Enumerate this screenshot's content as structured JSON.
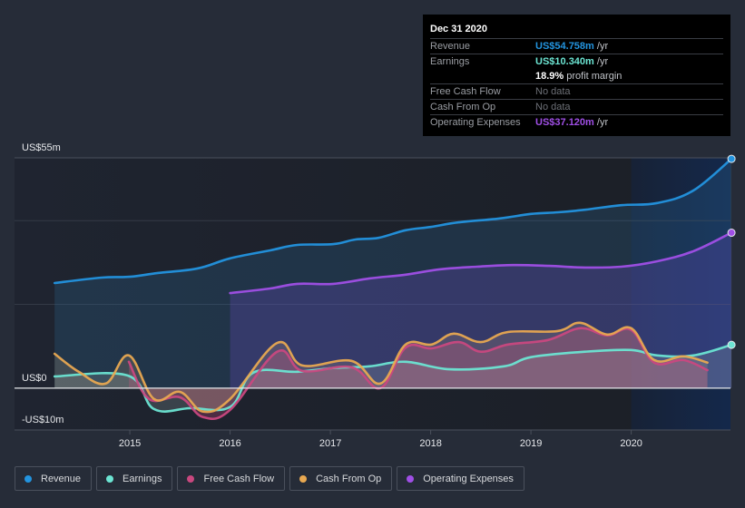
{
  "tooltip": {
    "date": "Dec 31 2020",
    "rows": [
      {
        "label": "Revenue",
        "value": "US$54.758m",
        "unit": "/yr",
        "color": "#2394df"
      },
      {
        "label": "Earnings",
        "value": "US$10.340m",
        "unit": "/yr",
        "color": "#6ce5d3"
      },
      {
        "label": "",
        "value": "18.9%",
        "unit": "profit margin",
        "color": "#ffffff"
      },
      {
        "label": "Free Cash Flow",
        "value": "No data",
        "unit": "",
        "color": "#6d7077"
      },
      {
        "label": "Cash From Op",
        "value": "No data",
        "unit": "",
        "color": "#6d7077"
      },
      {
        "label": "Operating Expenses",
        "value": "US$37.120m",
        "unit": "/yr",
        "color": "#a04fe6"
      }
    ]
  },
  "legend": [
    {
      "label": "Revenue",
      "color": "#2394df"
    },
    {
      "label": "Earnings",
      "color": "#6ce5d3"
    },
    {
      "label": "Free Cash Flow",
      "color": "#c9487f"
    },
    {
      "label": "Cash From Op",
      "color": "#e8a851"
    },
    {
      "label": "Operating Expenses",
      "color": "#a04fe6"
    }
  ],
  "chart_data": {
    "type": "line",
    "title": "",
    "xlabel": "",
    "ylabel": "",
    "y_tick_labels": [
      "US$55m",
      "US$0",
      "-US$10m"
    ],
    "ylim": [
      -10,
      55
    ],
    "xlim": [
      2013.85,
      2020.99
    ],
    "x_tick_labels": [
      "2015",
      "2016",
      "2017",
      "2018",
      "2019",
      "2020"
    ],
    "x_ticks": [
      2015,
      2016,
      2017,
      2018,
      2019,
      2020
    ],
    "grid": true,
    "legend_position": "bottom-left",
    "forecast_shade_start": 2020.0,
    "series": [
      {
        "name": "Revenue",
        "color": "#2394df",
        "fill": true,
        "x": [
          2014.25,
          2014.72,
          2015.0,
          2015.28,
          2015.68,
          2016.0,
          2016.4,
          2016.67,
          2017.03,
          2017.25,
          2017.48,
          2017.75,
          2018.0,
          2018.28,
          2018.68,
          2019.0,
          2019.27,
          2019.54,
          2019.9,
          2020.26,
          2020.62,
          2021.0
        ],
        "y": [
          25.1,
          26.4,
          26.6,
          27.5,
          28.6,
          31.0,
          32.9,
          34.2,
          34.4,
          35.5,
          35.9,
          37.7,
          38.5,
          39.6,
          40.5,
          41.6,
          42.0,
          42.6,
          43.7,
          44.2,
          47.2,
          54.758
        ],
        "end_marker": true
      },
      {
        "name": "Operating Expenses",
        "color": "#a04fe6",
        "fill": true,
        "x": [
          2016.0,
          2016.4,
          2016.67,
          2017.03,
          2017.39,
          2017.75,
          2018.1,
          2018.46,
          2018.82,
          2019.18,
          2019.54,
          2019.9,
          2020.26,
          2020.62,
          2021.0
        ],
        "y": [
          22.7,
          23.8,
          24.9,
          24.9,
          26.2,
          27.1,
          28.4,
          29.0,
          29.4,
          29.2,
          28.8,
          29.0,
          30.3,
          32.7,
          37.12
        ],
        "end_marker": true
      },
      {
        "name": "Earnings",
        "color": "#6ce5d3",
        "fill": true,
        "x": [
          2014.25,
          2014.98,
          2015.24,
          2015.6,
          2016.0,
          2016.23,
          2016.67,
          2017.03,
          2017.39,
          2017.75,
          2018.19,
          2018.73,
          2019.0,
          2019.54,
          2020.0,
          2020.26,
          2020.62,
          2021.0
        ],
        "y": [
          2.8,
          3.0,
          -5.0,
          -4.8,
          -4.5,
          3.7,
          3.9,
          4.8,
          5.2,
          6.3,
          4.5,
          5.2,
          7.4,
          8.7,
          9.1,
          7.8,
          7.8,
          10.34
        ],
        "end_marker": true
      },
      {
        "name": "Free Cash Flow",
        "color": "#c9487f",
        "fill": true,
        "x": [
          2014.99,
          2015.19,
          2015.5,
          2015.73,
          2016.0,
          2016.47,
          2016.72,
          2017.21,
          2017.5,
          2017.75,
          2018.01,
          2018.28,
          2018.5,
          2018.77,
          2019.17,
          2019.49,
          2019.76,
          2020.0,
          2020.23,
          2020.52,
          2020.76
        ],
        "y": [
          6.3,
          -2.6,
          -2.2,
          -6.9,
          -5.2,
          8.7,
          4.1,
          5.0,
          0.0,
          9.7,
          9.5,
          11.0,
          8.7,
          10.4,
          11.5,
          14.3,
          12.6,
          13.9,
          6.1,
          6.7,
          4.3
        ],
        "end_marker": false
      },
      {
        "name": "Cash From Op",
        "color": "#e8a851",
        "fill": true,
        "x": [
          2014.25,
          2014.49,
          2014.76,
          2014.99,
          2015.24,
          2015.5,
          2015.73,
          2016.0,
          2016.47,
          2016.72,
          2017.21,
          2017.5,
          2017.75,
          2018.01,
          2018.23,
          2018.5,
          2018.77,
          2019.26,
          2019.49,
          2019.76,
          2020.0,
          2020.23,
          2020.52,
          2020.76
        ],
        "y": [
          8.2,
          3.9,
          1.1,
          7.8,
          -2.6,
          -0.9,
          -5.6,
          -2.6,
          10.8,
          5.4,
          6.5,
          1.1,
          10.4,
          10.4,
          13.0,
          11.0,
          13.4,
          13.6,
          15.6,
          12.8,
          14.3,
          6.7,
          7.6,
          6.1
        ],
        "end_marker": false
      }
    ]
  }
}
